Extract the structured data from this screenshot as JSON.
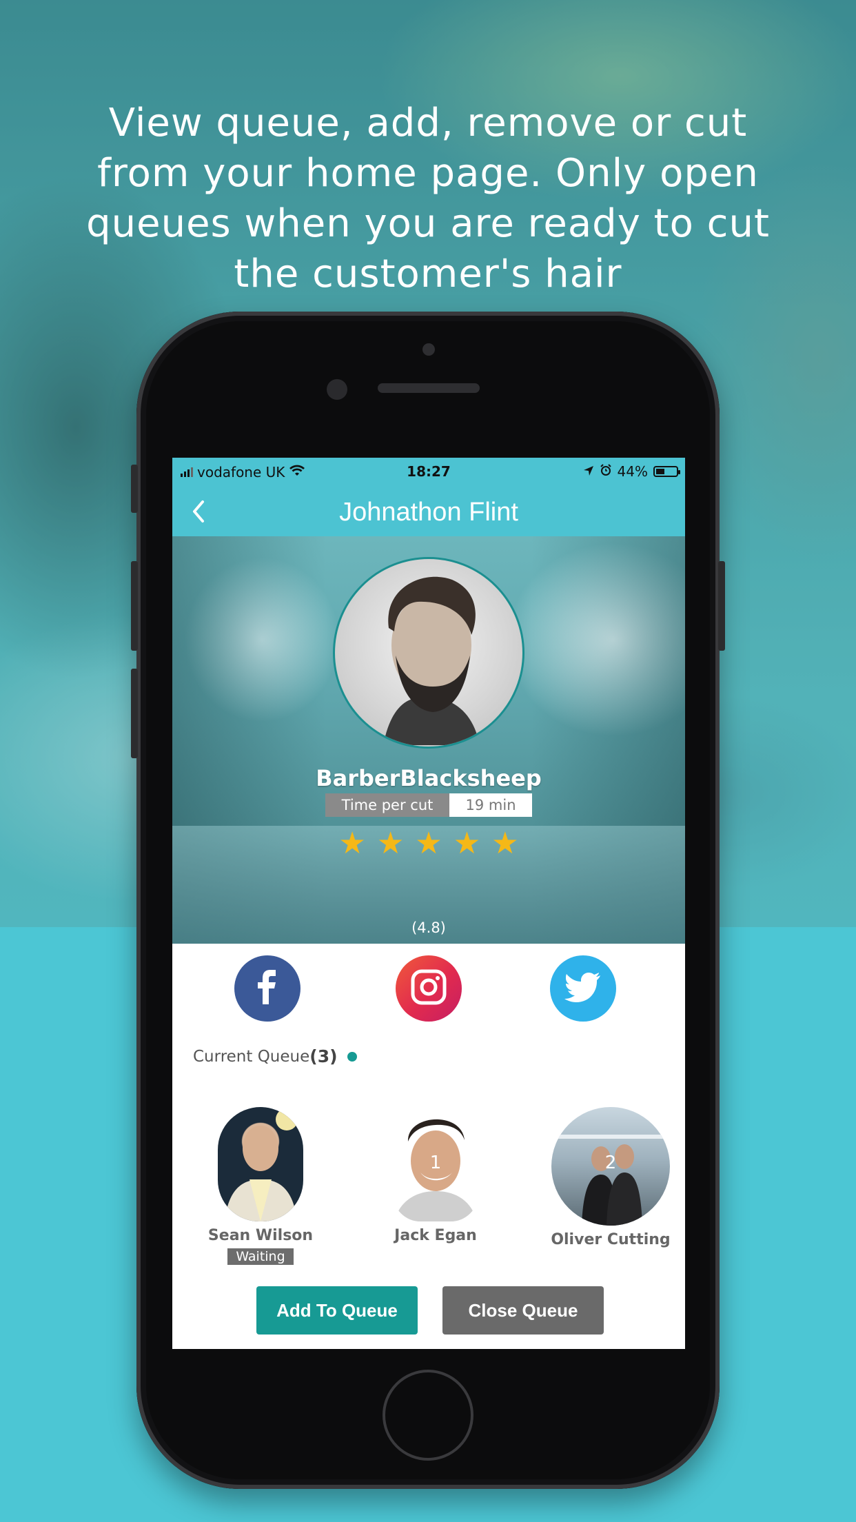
{
  "headline": "View queue, add, remove or cut from your home page. Only open queues when you are ready to cut the customer's hair",
  "status_bar": {
    "carrier": "vodafone UK",
    "time": "18:27",
    "battery": "44%",
    "battery_level": 0.44
  },
  "nav": {
    "title": "Johnathon Flint",
    "back_icon": "chevron-left-icon"
  },
  "profile": {
    "shop_name": "BarberBlacksheep",
    "time_per_cut_label": "Time per cut",
    "time_per_cut_value": "19 min",
    "rating": 4.8,
    "rating_text": "(4.8)",
    "stars_max": 5
  },
  "social": [
    "facebook-icon",
    "instagram-icon",
    "twitter-icon"
  ],
  "queue": {
    "label": "Current Queue",
    "count": "(3)",
    "people": [
      {
        "name": "Sean Wilson",
        "status": "Waiting",
        "position": ""
      },
      {
        "name": "Jack Egan",
        "status": "",
        "position": "1"
      },
      {
        "name": "Oliver Cutting",
        "status": "",
        "position": "2"
      }
    ]
  },
  "buttons": {
    "add": "Add To Queue",
    "close": "Close Queue"
  },
  "colors": {
    "accent": "#4cc3d2",
    "primary_button": "#179a94",
    "secondary_button": "#6a6a6a",
    "star": "#f5b817"
  }
}
